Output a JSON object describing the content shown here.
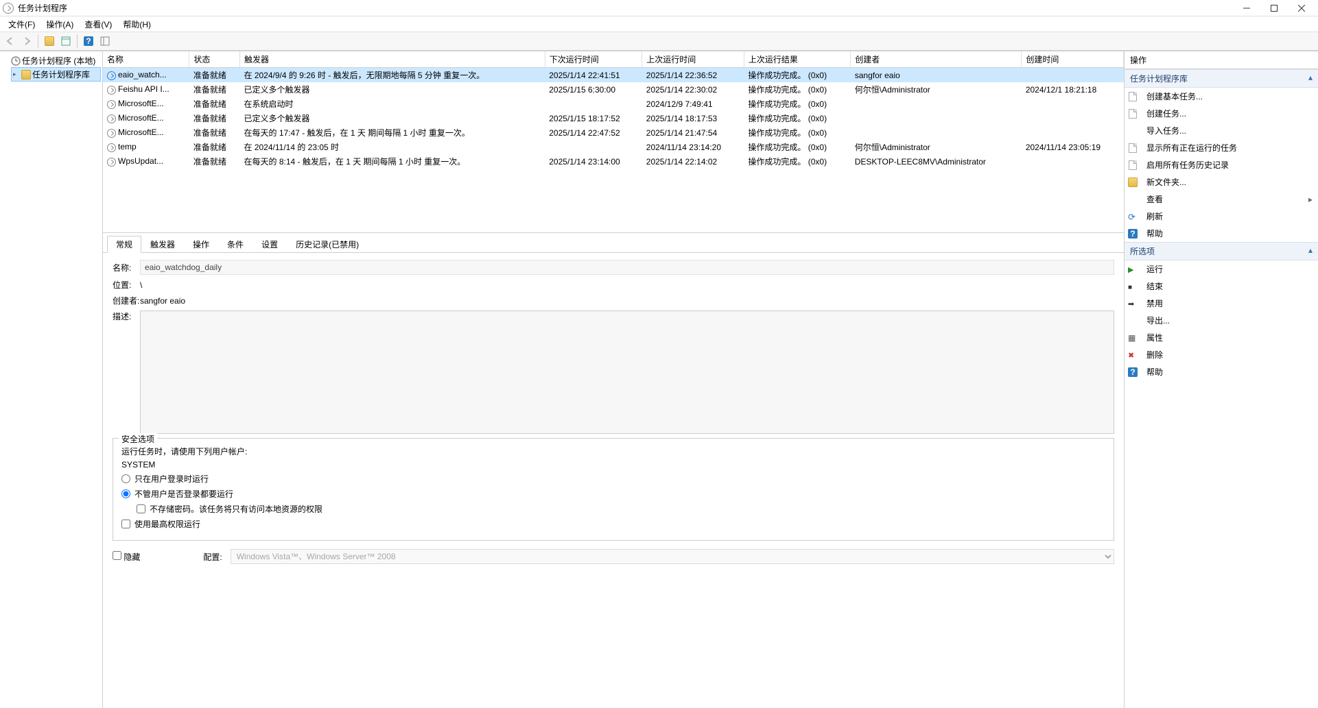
{
  "titlebar": {
    "title": "任务计划程序"
  },
  "menubar": [
    "文件(F)",
    "操作(A)",
    "查看(V)",
    "帮助(H)"
  ],
  "tree": {
    "root": "任务计划程序 (本地)",
    "library": "任务计划程序库"
  },
  "table": {
    "headers": [
      "名称",
      "状态",
      "触发器",
      "下次运行时间",
      "上次运行时间",
      "上次运行结果",
      "创建者",
      "创建时间"
    ],
    "rows": [
      {
        "name": "eaio_watch...",
        "status": "准备就绪",
        "trigger": "在 2024/9/4 的 9:26 时 - 触发后，无限期地每隔 5 分钟 重复一次。",
        "next": "2025/1/14 22:41:51",
        "last": "2025/1/14 22:36:52",
        "result": "操作成功完成。 (0x0)",
        "author": "sangfor eaio",
        "created": "",
        "selected": true,
        "blue": true
      },
      {
        "name": "Feishu API I...",
        "status": "准备就绪",
        "trigger": "已定义多个触发器",
        "next": "2025/1/15 6:30:00",
        "last": "2025/1/14 22:30:02",
        "result": "操作成功完成。 (0x0)",
        "author": "何尔恒\\Administrator",
        "created": "2024/12/1 18:21:18"
      },
      {
        "name": "MicrosoftE...",
        "status": "准备就绪",
        "trigger": "在系统启动时",
        "next": "",
        "last": "2024/12/9 7:49:41",
        "result": "操作成功完成。 (0x0)",
        "author": "",
        "created": ""
      },
      {
        "name": "MicrosoftE...",
        "status": "准备就绪",
        "trigger": "已定义多个触发器",
        "next": "2025/1/15 18:17:52",
        "last": "2025/1/14 18:17:53",
        "result": "操作成功完成。 (0x0)",
        "author": "",
        "created": ""
      },
      {
        "name": "MicrosoftE...",
        "status": "准备就绪",
        "trigger": "在每天的 17:47 - 触发后，在 1 天 期间每隔 1 小时 重复一次。",
        "next": "2025/1/14 22:47:52",
        "last": "2025/1/14 21:47:54",
        "result": "操作成功完成。 (0x0)",
        "author": "",
        "created": ""
      },
      {
        "name": "temp",
        "status": "准备就绪",
        "trigger": "在 2024/11/14 的 23:05 时",
        "next": "",
        "last": "2024/11/14 23:14:20",
        "result": "操作成功完成。 (0x0)",
        "author": "何尔恒\\Administrator",
        "created": "2024/11/14 23:05:19"
      },
      {
        "name": "WpsUpdat...",
        "status": "准备就绪",
        "trigger": "在每天的 8:14 - 触发后，在 1 天 期间每隔 1 小时 重复一次。",
        "next": "2025/1/14 23:14:00",
        "last": "2025/1/14 22:14:02",
        "result": "操作成功完成。 (0x0)",
        "author": "DESKTOP-LEEC8MV\\Administrator",
        "created": ""
      }
    ]
  },
  "tabs": [
    "常规",
    "触发器",
    "操作",
    "条件",
    "设置",
    "历史记录(已禁用)"
  ],
  "general": {
    "name_label": "名称:",
    "name_value": "eaio_watchdog_daily",
    "location_label": "位置:",
    "location_value": "\\",
    "author_label": "创建者:",
    "author_value": "sangfor eaio",
    "desc_label": "描述:",
    "desc_value": "",
    "security_legend": "安全选项",
    "account_text": "运行任务时，请使用下列用户帐户:",
    "account_value": "SYSTEM",
    "opt_logged_on": "只在用户登录时运行",
    "opt_any": "不管用户是否登录都要运行",
    "opt_nopass": "不存储密码。该任务将只有访问本地资源的权限",
    "opt_highest": "使用最高权限运行",
    "hidden_label": "隐藏",
    "config_label": "配置:",
    "config_value": "Windows Vista™、Windows Server™ 2008"
  },
  "actions": {
    "header": "操作",
    "section1": "任务计划程序库",
    "items1": [
      {
        "icon": "doc",
        "label": "创建基本任务..."
      },
      {
        "icon": "doc",
        "label": "创建任务..."
      },
      {
        "icon": "",
        "label": "导入任务..."
      },
      {
        "icon": "doc",
        "label": "显示所有正在运行的任务"
      },
      {
        "icon": "doc",
        "label": "启用所有任务历史记录"
      },
      {
        "icon": "folder",
        "label": "新文件夹..."
      },
      {
        "icon": "",
        "label": "查看",
        "arrow": true
      },
      {
        "icon": "refresh",
        "label": "刷新"
      },
      {
        "icon": "help",
        "label": "帮助"
      }
    ],
    "section2": "所选项",
    "items2": [
      {
        "icon": "run",
        "label": "运行"
      },
      {
        "icon": "stop",
        "label": "结束"
      },
      {
        "icon": "disable",
        "label": "禁用"
      },
      {
        "icon": "",
        "label": "导出..."
      },
      {
        "icon": "prop",
        "label": "属性"
      },
      {
        "icon": "del",
        "label": "删除"
      },
      {
        "icon": "help",
        "label": "帮助"
      }
    ]
  }
}
